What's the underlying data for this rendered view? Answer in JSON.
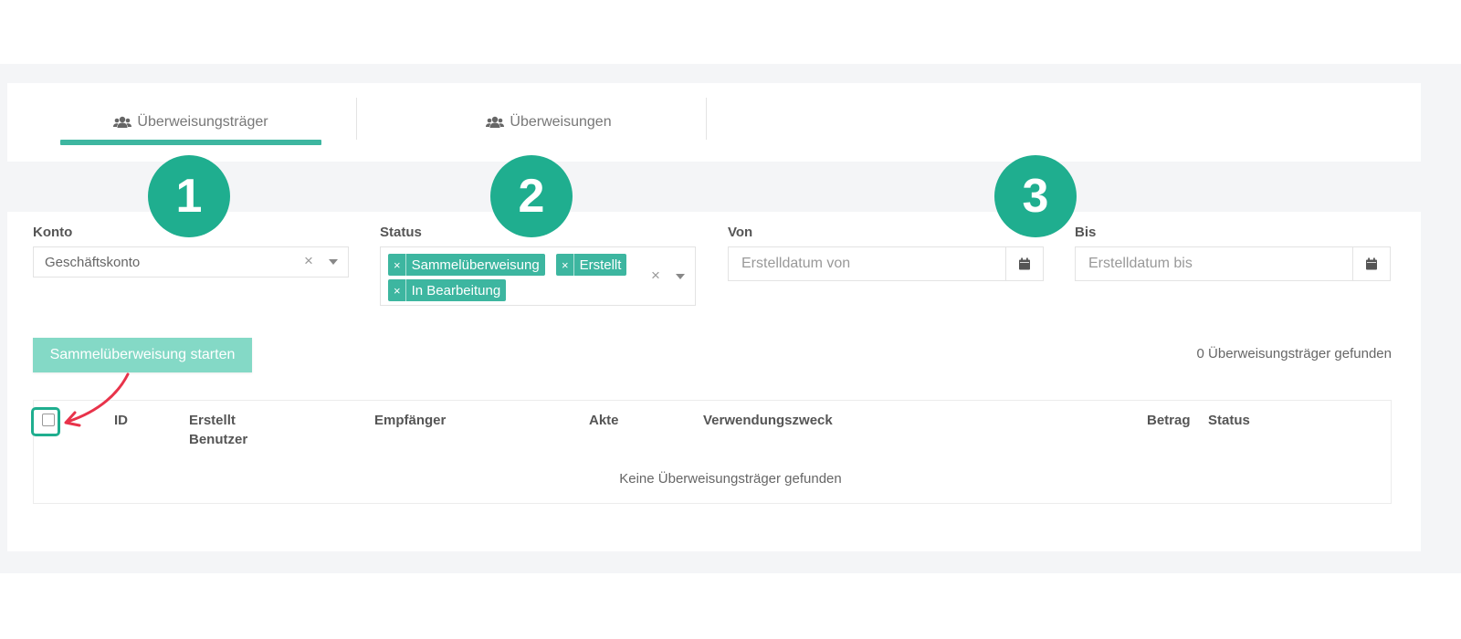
{
  "tabs": [
    {
      "label": "Überweisungsträger",
      "icon": "users-icon",
      "active": true
    },
    {
      "label": "Überweisungen",
      "icon": "users-icon",
      "active": false
    }
  ],
  "badges": [
    "1",
    "2",
    "3"
  ],
  "filters": {
    "konto": {
      "label": "Konto",
      "value": "Geschäftskonto"
    },
    "status": {
      "label": "Status",
      "chips": [
        "Sammelüberweisung",
        "Erstellt",
        "In Bearbeitung"
      ]
    },
    "von": {
      "label": "Von",
      "placeholder": "Erstelldatum von"
    },
    "bis": {
      "label": "Bis",
      "placeholder": "Erstelldatum bis"
    }
  },
  "actions": {
    "start_label": "Sammelüberweisung starten"
  },
  "found_count": "0 Überweisungsträger gefunden",
  "table": {
    "columns": {
      "id": "ID",
      "erstellt": "Erstellt",
      "benutzer": "Benutzer",
      "empfaenger": "Empfänger",
      "akte": "Akte",
      "verwendungszweck": "Verwendungszweck",
      "betrag": "Betrag",
      "status": "Status"
    },
    "empty_message": "Keine Überweisungsträger gefunden"
  },
  "colors": {
    "accent": "#3db6a0",
    "badge": "#1fae8f",
    "arrow": "#e8334a",
    "button_disabled": "#84d9c6"
  }
}
